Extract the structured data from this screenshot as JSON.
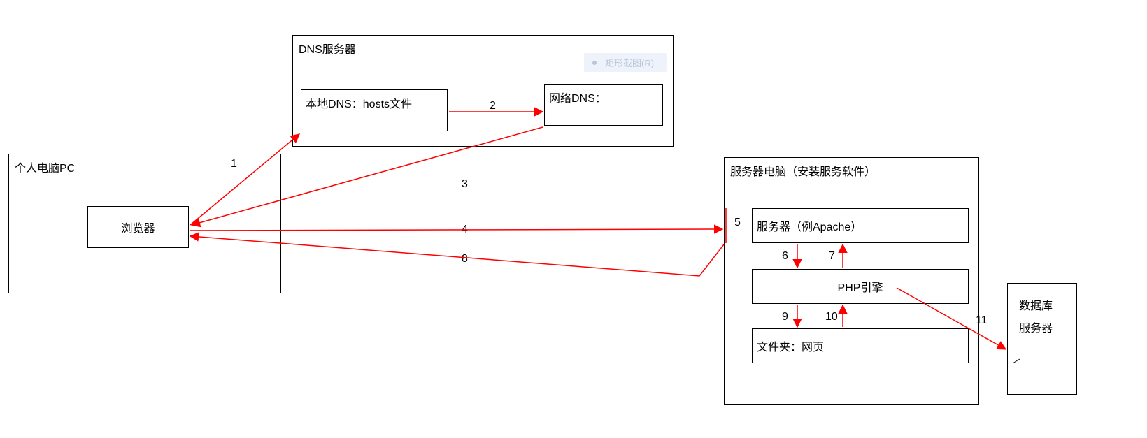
{
  "pc": {
    "title": "个人电脑PC",
    "browser": "浏览器"
  },
  "dns": {
    "title": "DNS服务器",
    "local": "本地DNS：hosts文件",
    "network": "网络DNS："
  },
  "server": {
    "title": "服务器电脑（安装服务软件）",
    "apache": "服务器（例Apache）",
    "php": "PHP引擎",
    "folder": "文件夹：网页"
  },
  "db": {
    "line1": "数据库",
    "line2": "服务器"
  },
  "hint": "矩形截图(R)",
  "steps": {
    "s1": "1",
    "s2": "2",
    "s3": "3",
    "s4": "4",
    "s5": "5",
    "s6": "6",
    "s7": "7",
    "s8": "8",
    "s9": "9",
    "s10": "10",
    "s11": "11"
  }
}
